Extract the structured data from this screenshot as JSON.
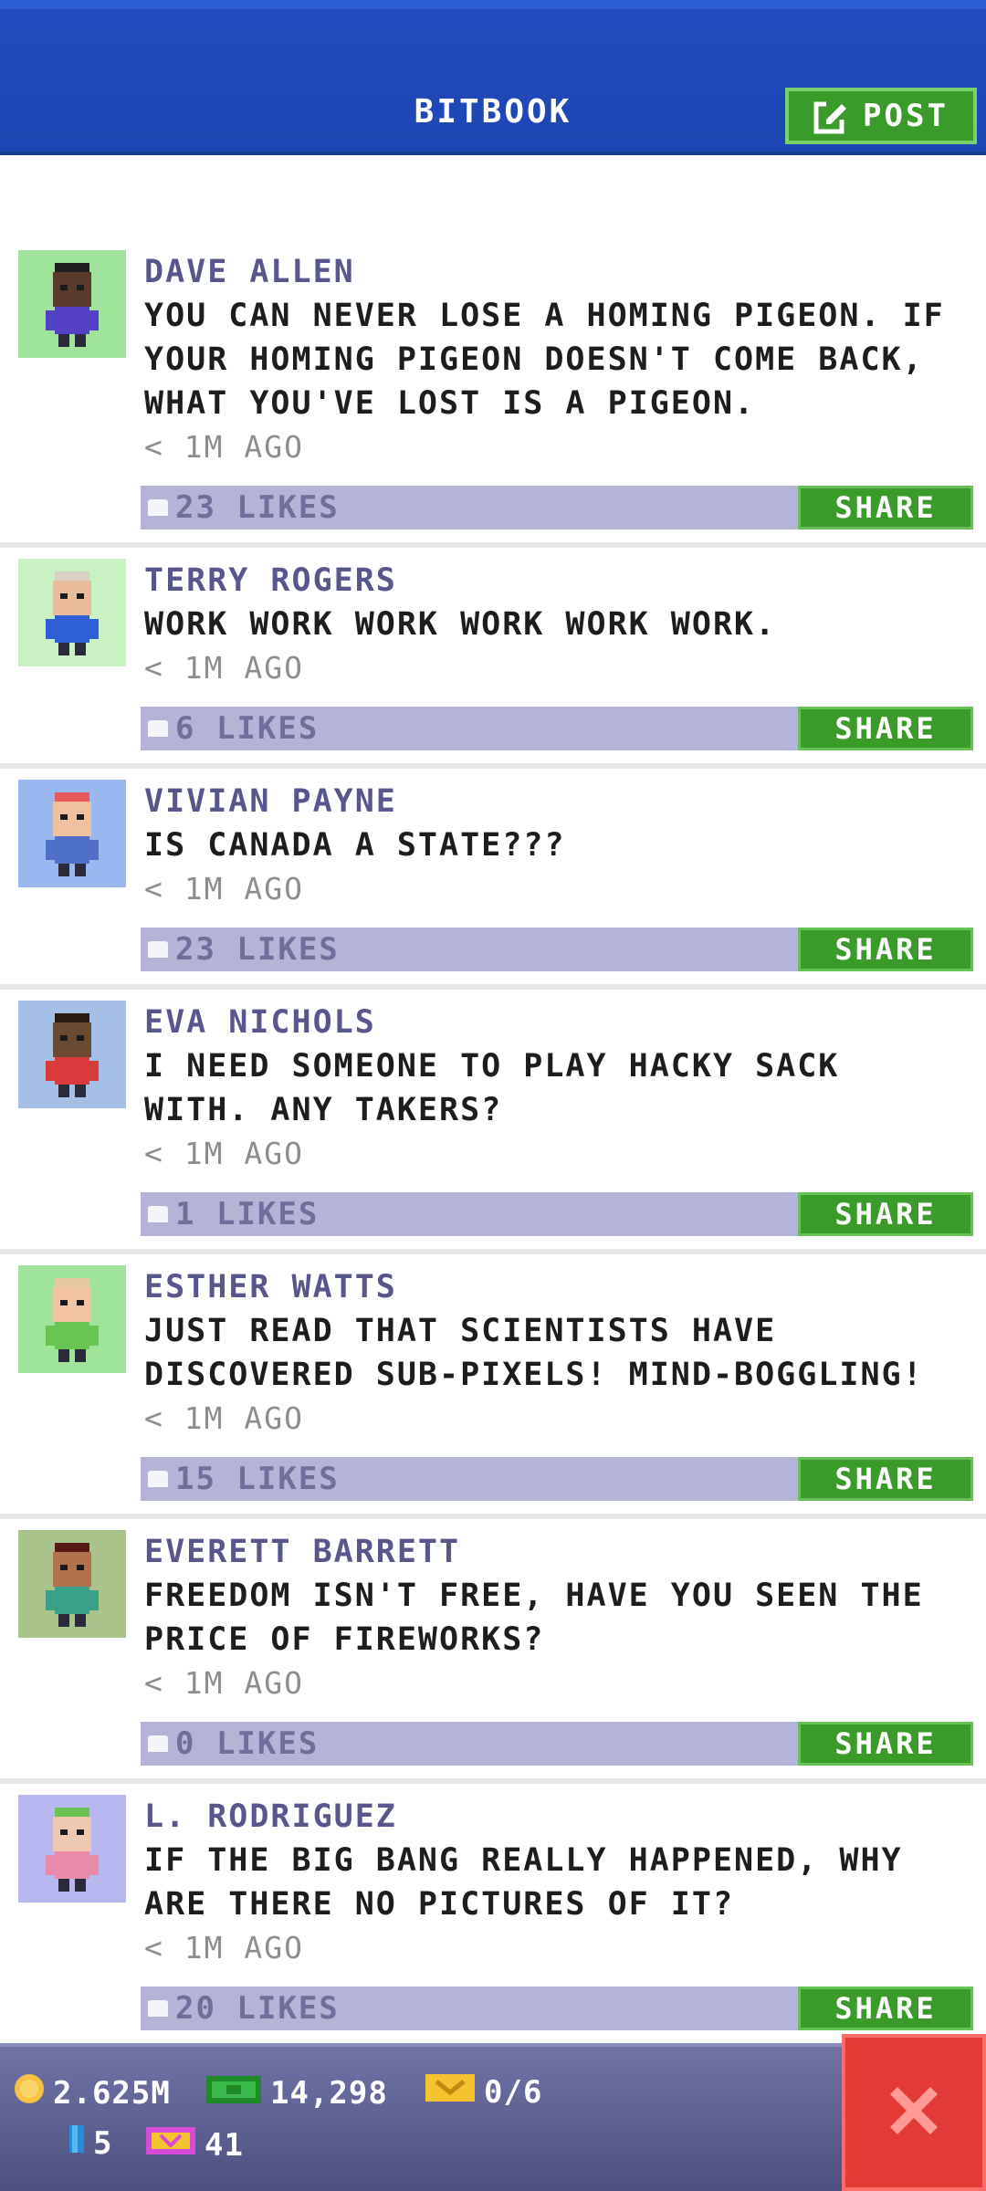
{
  "header": {
    "title": "BITBOOK",
    "post_label": "POST"
  },
  "feed": [
    {
      "author": "DAVE ALLEN",
      "text": "YOU CAN NEVER LOSE A HOMING PIGEON. IF YOUR HOMING PIGEON DOESN'T COME BACK, WHAT YOU'VE LOST IS A PIGEON.",
      "time": "< 1M AGO",
      "likes": "23 LIKES",
      "share": "SHARE",
      "avatar_bg": "#9fe49a",
      "skin": "#5a3a28",
      "shirt": "#5440c4",
      "hair": "#1e1e1e"
    },
    {
      "author": "TERRY ROGERS",
      "text": "WORK WORK WORK WORK WORK WORK.",
      "time": "< 1M AGO",
      "likes": "6 LIKES",
      "share": "SHARE",
      "avatar_bg": "#c8f2c2",
      "skin": "#e8bb9a",
      "shirt": "#2e5fd4",
      "hair": "#d9d2c4"
    },
    {
      "author": "VIVIAN PAYNE",
      "text": "IS CANADA A STATE???",
      "time": "< 1M AGO",
      "likes": "23 LIKES",
      "share": "SHARE",
      "avatar_bg": "#9ab8f0",
      "skin": "#f0c0a0",
      "shirt": "#4f6fc8",
      "hair": "#e85a5a"
    },
    {
      "author": "EVA NICHOLS",
      "text": "I NEED SOMEONE TO PLAY HACKY SACK WITH. ANY TAKERS?",
      "time": "< 1M AGO",
      "likes": "1 LIKES",
      "share": "SHARE",
      "avatar_bg": "#a6bfe6",
      "skin": "#6b4a32",
      "shirt": "#d93a3a",
      "hair": "#2a1a12"
    },
    {
      "author": "ESTHER WATTS",
      "text": "JUST READ THAT SCIENTISTS HAVE DISCOVERED SUB-PIXELS! MIND-BOGGLING!",
      "time": "< 1M AGO",
      "likes": "15 LIKES",
      "share": "SHARE",
      "avatar_bg": "#9fe49a",
      "skin": "#f0c4a4",
      "shirt": "#6ac454",
      "hair": "#e8c8a0"
    },
    {
      "author": "EVERETT BARRETT",
      "text": "FREEDOM ISN'T FREE, HAVE YOU SEEN THE PRICE OF FIREWORKS?",
      "time": "< 1M AGO",
      "likes": "0 LIKES",
      "share": "SHARE",
      "avatar_bg": "#a9c48a",
      "skin": "#b0744c",
      "shirt": "#3aa08a",
      "hair": "#5a1a14"
    },
    {
      "author": "L. RODRIGUEZ",
      "text": "IF THE BIG BANG REALLY HAPPENED, WHY ARE THERE NO PICTURES OF IT?",
      "time": "< 1M AGO",
      "likes": "20 LIKES",
      "share": "SHARE",
      "avatar_bg": "#b8b8f0",
      "skin": "#f0c8b0",
      "shirt": "#e88aa8",
      "hair": "#6ac454"
    }
  ],
  "status": {
    "coins": "2.625M",
    "bux": "14,298",
    "tickets": "0/6",
    "items": "5",
    "vip": "41"
  },
  "colors": {
    "header_blue": "#1f4cbf",
    "green_button": "#3a9a2a",
    "action_bar": "#b3b4d8",
    "author_color": "#57578e",
    "close_red": "#e43a36"
  }
}
